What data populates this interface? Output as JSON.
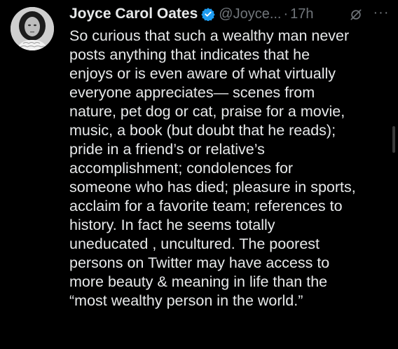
{
  "tweet": {
    "display_name": "Joyce Carol Oates",
    "handle": "@Joyce...",
    "separator": "·",
    "time": "17h",
    "more_glyph": "···",
    "icons": {
      "verified": "verified-badge-icon",
      "grok": "grok-icon",
      "more": "more-options-icon"
    },
    "colors": {
      "background": "#000000",
      "text": "#e7e9ea",
      "secondary": "#71767b",
      "verified": "#1d9bf0"
    },
    "body_lines": [
      "So curious that such a wealthy man never",
      "posts anything that indicates that he",
      "enjoys or is even aware of what virtually",
      "everyone appreciates— scenes from",
      "nature, pet dog or cat, praise for a movie,",
      "music, a book (but doubt that he reads);",
      "pride in a friend’s or relative’s",
      "accomplishment; condolences for",
      "someone who has died; pleasure in sports,",
      "acclaim for a favorite team;  references to",
      "history.  In fact he seems totally",
      "uneducated , uncultured. The poorest",
      "persons on Twitter may have access to",
      "more beauty & meaning in life than the",
      "“most wealthy person in the world.”"
    ]
  }
}
